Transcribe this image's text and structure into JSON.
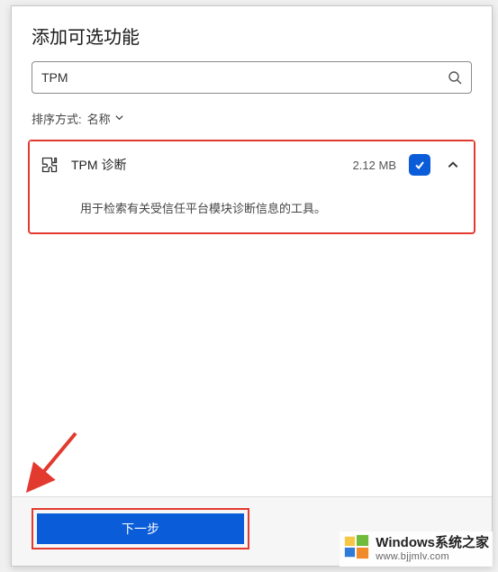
{
  "dialog": {
    "title": "添加可选功能"
  },
  "search": {
    "value": "TPM"
  },
  "sort": {
    "label": "排序方式:",
    "value": "名称"
  },
  "feature": {
    "name": "TPM 诊断",
    "size": "2.12 MB",
    "checked": true,
    "description": "用于检索有关受信任平台模块诊断信息的工具。"
  },
  "footer": {
    "next_label": "下一步"
  },
  "watermark": {
    "title": "Windows系统之家",
    "url": "www.bjjmlv.com"
  }
}
